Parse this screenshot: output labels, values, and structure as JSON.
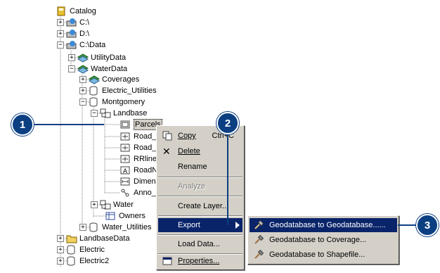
{
  "tree": {
    "catalog": "Catalog",
    "c_drive": "C:\\",
    "d_drive": "D:\\",
    "c_data": "C:\\Data",
    "utility_data": "UtilityData",
    "water_data": "WaterData",
    "coverages": "Coverages",
    "electric_utilities": "Electric_Utilities",
    "montgomery": "Montgomery",
    "landbase": "Landbase",
    "parcels": "Parcels",
    "road1": "Road_",
    "road2": "Road_",
    "rrline": "RRline",
    "roadn": "RoadN",
    "dimens": "Dimens",
    "anno": "Anno_",
    "water": "Water",
    "owners": "Owners",
    "water_utilities": "Water_Utilities",
    "landbase_data": "LandbaseData",
    "electric": "Electric",
    "electric2": "Electric2"
  },
  "context_menu": {
    "copy": "Copy",
    "copy_shortcut": "Ctrl+C",
    "delete": "Delete",
    "rename": "Rename",
    "analyze": "Analyze",
    "create_layer": "Create Layer...",
    "export": "Export",
    "load_data": "Load Data...",
    "properties": "Properties..."
  },
  "submenu": {
    "gdb_to_gdb": "Geodatabase to Geodatabase......",
    "gdb_to_coverage": "Geodatabase to Coverage...",
    "gdb_to_shapefile": "Geodatabase to Shapefile..."
  },
  "callouts": [
    "1",
    "2",
    "3"
  ],
  "colors": {
    "callout": "#0b3f82",
    "highlight": "#0a246a",
    "menu_bg": "#d4d0c8"
  }
}
